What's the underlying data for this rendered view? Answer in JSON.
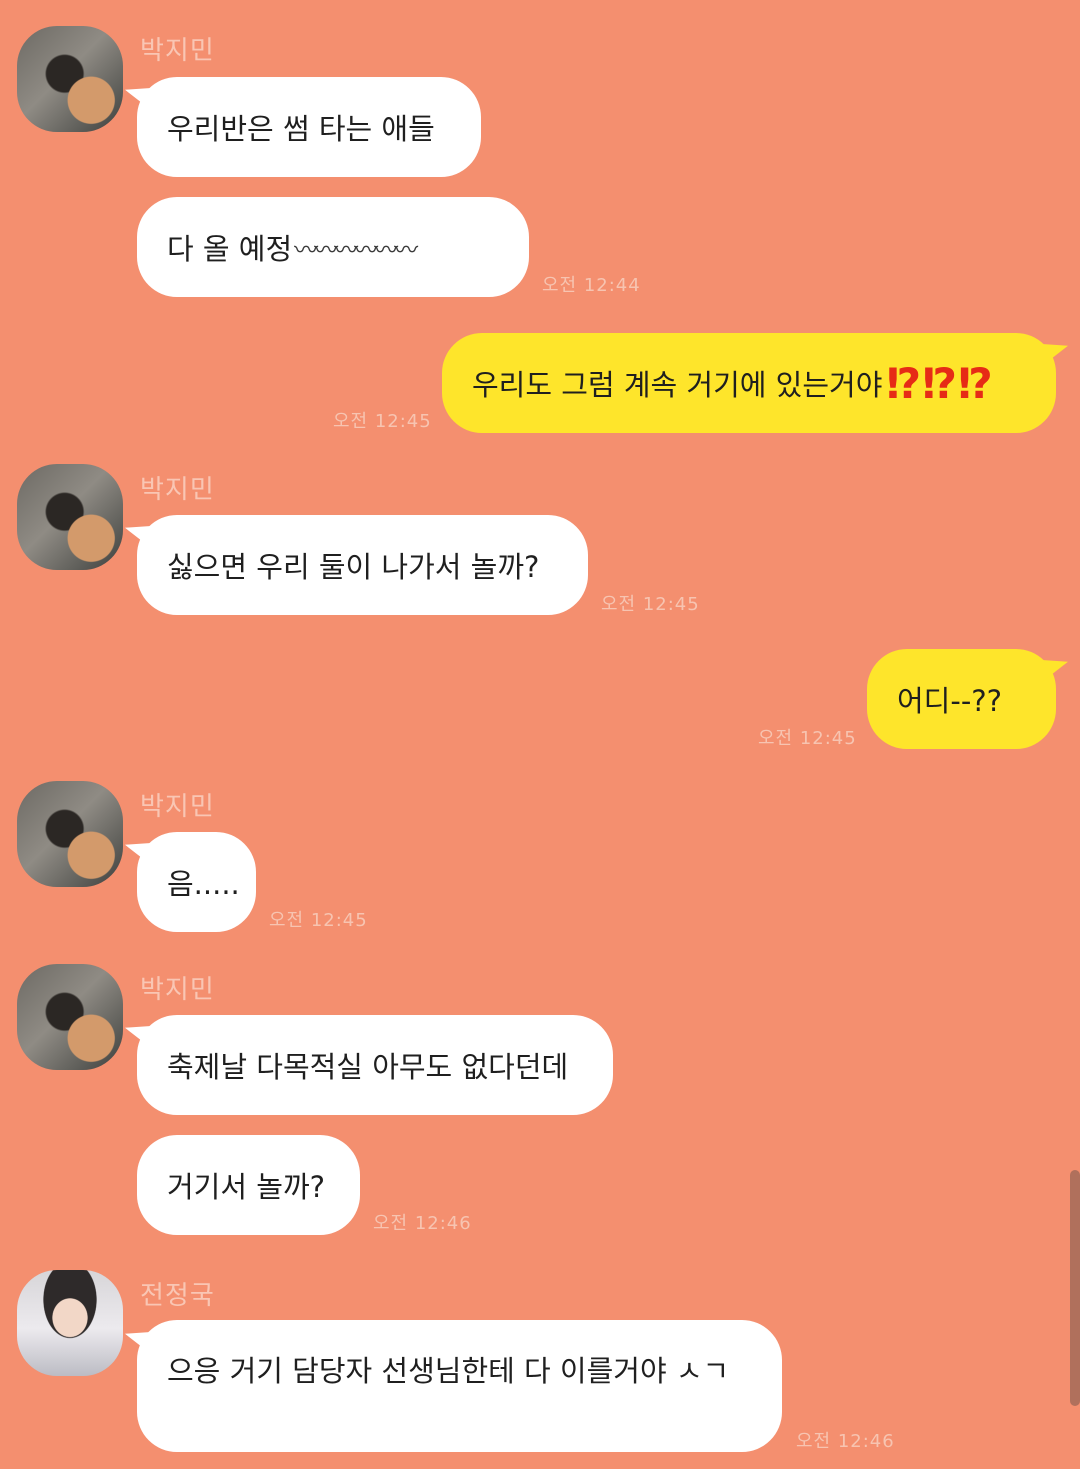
{
  "messages": [
    {
      "sender": "박지민",
      "text": "우리반은 썸 타는 애들"
    },
    {
      "sender": "박지민",
      "text": "다 올 예정",
      "decoration": "〰〰〰〰〰〰",
      "time": "오전 12:44"
    },
    {
      "sender": "me",
      "text": "우리도 그럼 계속 거기에 있는거야",
      "emphasis": "⁉⁉⁉",
      "time": "오전 12:45"
    },
    {
      "sender": "박지민",
      "text": "싫으면 우리 둘이 나가서 놀까?",
      "time": "오전 12:45"
    },
    {
      "sender": "me",
      "text": "어디--??",
      "time": "오전 12:45"
    },
    {
      "sender": "박지민",
      "text": "음.....",
      "time": "오전 12:45"
    },
    {
      "sender": "박지민",
      "text": "축제날 다목적실 아무도 없다던데"
    },
    {
      "sender": "박지민",
      "text": "거기서 놀까?",
      "time": "오전 12:46"
    },
    {
      "sender": "전정국",
      "text": "으응 거기 담당자 선생님한테 다 이를거야 ㅅㄱ",
      "time": "오전 12:46"
    }
  ],
  "colors": {
    "background": "#f48f6f",
    "incoming_bubble": "#ffffff",
    "outgoing_bubble": "#fee52b",
    "emphasis": "#e62b16"
  }
}
